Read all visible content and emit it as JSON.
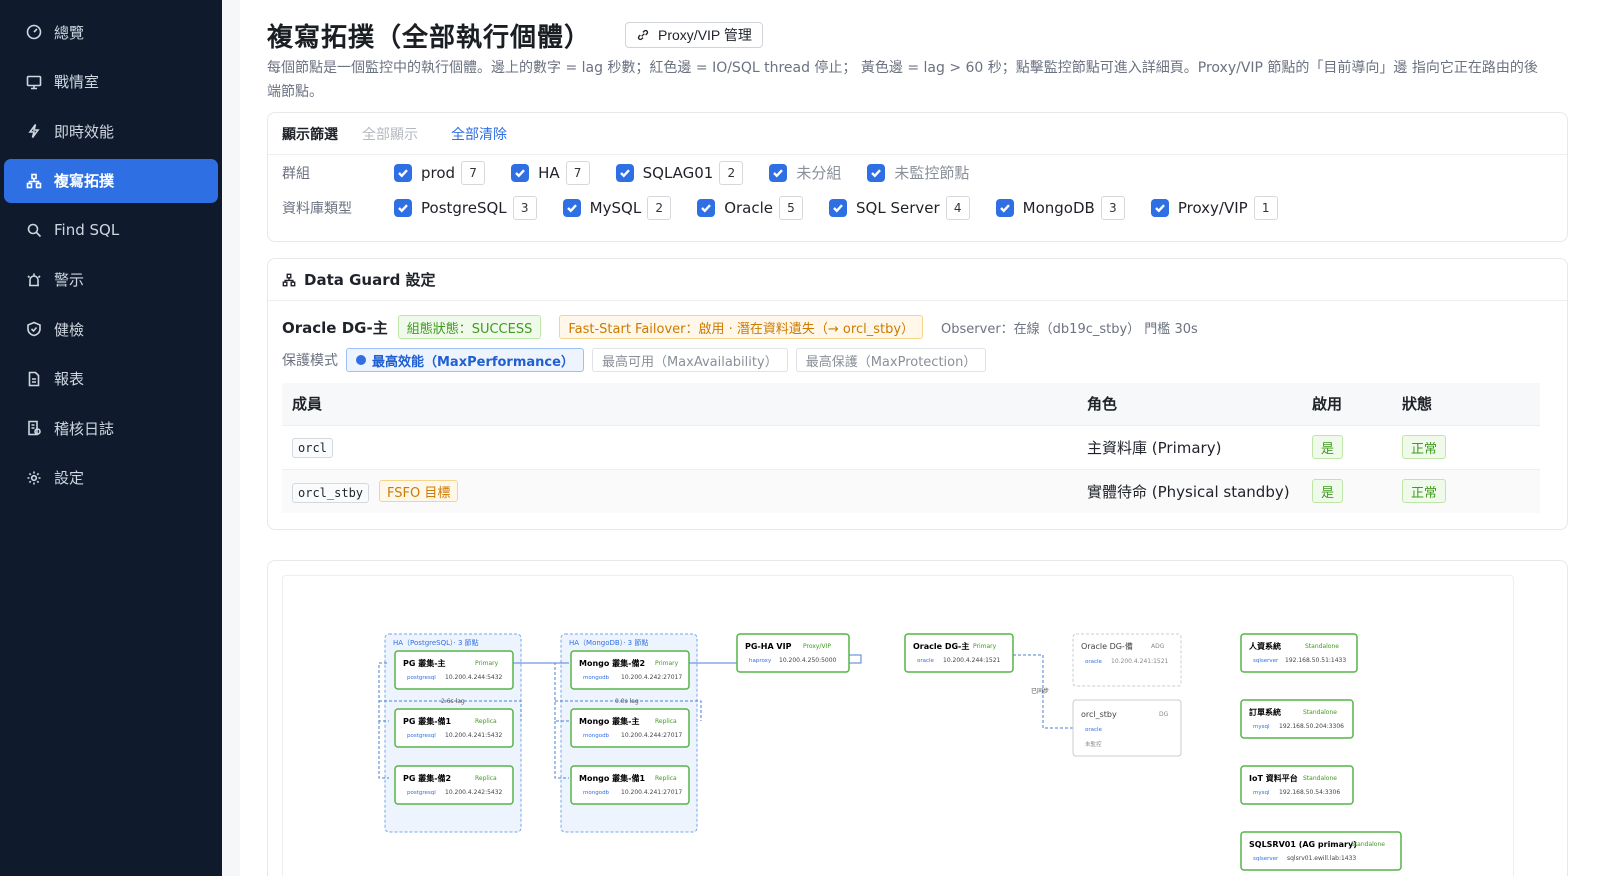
{
  "sidebar": {
    "items": [
      {
        "label": "總覽",
        "icon": "dashboard-icon"
      },
      {
        "label": "戰情室",
        "icon": "monitor-icon"
      },
      {
        "label": "即時效能",
        "icon": "bolt-icon"
      },
      {
        "label": "複寫拓撲",
        "icon": "topology-icon"
      },
      {
        "label": "Find SQL",
        "icon": "search-icon"
      },
      {
        "label": "警示",
        "icon": "alarm-icon"
      },
      {
        "label": "健檢",
        "icon": "shield-icon"
      },
      {
        "label": "報表",
        "icon": "report-icon"
      },
      {
        "label": "稽核日誌",
        "icon": "audit-log-icon"
      },
      {
        "label": "設定",
        "icon": "gear-icon"
      }
    ],
    "active": "複寫拓撲"
  },
  "page": {
    "title": "複寫拓撲（全部執行個體）",
    "proxy_button": "Proxy/VIP 管理",
    "description": "每個節點是一個監控中的執行個體。邊上的數字 = lag 秒數；紅色邊 = IO/SQL thread 停止； 黃色邊 = lag > 60 秒；點擊監控節點可進入詳細頁。Proxy/VIP 節點的「目前導向」邊 指向它正在路由的後端節點。"
  },
  "filters": {
    "title": "顯示篩選",
    "show_all": "全部顯示",
    "clear_all": "全部清除",
    "group_label": "群組",
    "groups": [
      {
        "label": "prod",
        "count": "7"
      },
      {
        "label": "HA",
        "count": "7"
      },
      {
        "label": "SQLAG01",
        "count": "2"
      },
      {
        "label": "未分組",
        "count": ""
      },
      {
        "label": "未監控節點",
        "count": ""
      }
    ],
    "db_type_label": "資料庫類型",
    "db_types": [
      {
        "label": "PostgreSQL",
        "count": "3"
      },
      {
        "label": "MySQL",
        "count": "2"
      },
      {
        "label": "Oracle",
        "count": "5"
      },
      {
        "label": "SQL Server",
        "count": "4"
      },
      {
        "label": "MongoDB",
        "count": "3"
      },
      {
        "label": "Proxy/VIP",
        "count": "1"
      }
    ]
  },
  "dataguard": {
    "title": "Data Guard 設定",
    "name": "Oracle DG-主",
    "status_tag": "組態狀態：SUCCESS",
    "fsfo_tag": "Fast-Start Failover：啟用 · 潛在資料遺失（→ orcl_stby）",
    "observer": "Observer：在線（db19c_stby） 門檻 30s",
    "mode_label": "保護模式",
    "modes": [
      "最高效能（MaxPerformance）",
      "最高可用（MaxAvailability）",
      "最高保護（MaxProtection）"
    ],
    "columns": [
      "成員",
      "角色",
      "啟用",
      "狀態"
    ],
    "members": [
      {
        "name": "orcl",
        "tag": "",
        "role": "主資料庫 (Primary)",
        "enabled": "是",
        "status": "正常"
      },
      {
        "name": "orcl_stby",
        "tag": "FSFO 目標",
        "role": "實體待命 (Physical standby)",
        "enabled": "是",
        "status": "正常"
      }
    ]
  },
  "topology": {
    "groups": [
      {
        "label": "HA（PostgreSQL）· 3 節點"
      },
      {
        "label": "HA（MongoDB）· 3 節點"
      }
    ],
    "nodes": [
      {
        "name": "PG 叢集-主",
        "role": "Primary",
        "type": "postgresql",
        "addr": "10.200.4.244:5432"
      },
      {
        "name": "PG 叢集-備1",
        "role": "Replica",
        "type": "postgresql",
        "addr": "10.200.4.241:5432"
      },
      {
        "name": "PG 叢集-備2",
        "role": "Replica",
        "type": "postgresql",
        "addr": "10.200.4.242:5432"
      },
      {
        "name": "Mongo 叢集-備2",
        "role": "Primary",
        "type": "mongodb",
        "addr": "10.200.4.242:27017"
      },
      {
        "name": "Mongo 叢集-主",
        "role": "Replica",
        "type": "mongodb",
        "addr": "10.200.4.244:27017"
      },
      {
        "name": "Mongo 叢集-備1",
        "role": "Replica",
        "type": "mongodb",
        "addr": "10.200.4.241:27017"
      },
      {
        "name": "PG-HA VIP",
        "role": "Proxy/VIP",
        "type": "haproxy",
        "addr": "10.200.4.250:5000"
      },
      {
        "name": "Oracle DG-主",
        "role": "Primary",
        "type": "oracle",
        "addr": "10.200.4.244:1521"
      },
      {
        "name": "Oracle DG-備",
        "role": "ADG",
        "type": "oracle",
        "addr": "10.200.4.241:1521"
      },
      {
        "name": "orcl_stby",
        "role": "DG",
        "type": "oracle",
        "addr": "未監控"
      },
      {
        "name": "人資系統",
        "role": "Standalone",
        "type": "sqlserver",
        "addr": "192.168.50.51:1433"
      },
      {
        "name": "訂單系統",
        "role": "Standalone",
        "type": "mysql",
        "addr": "192.168.50.204:3306"
      },
      {
        "name": "IoT 資料平台",
        "role": "Standalone",
        "type": "mysql",
        "addr": "192.168.50.54:3306"
      },
      {
        "name": "SQLSRV01 (AG primary)",
        "role": "Standalone",
        "type": "sqlserver",
        "addr": "sqlsrv01.ewill.lab:1433"
      }
    ],
    "lag_labels": [
      "2.6s lag",
      "0.0s lag"
    ],
    "sync_label": "已同步"
  },
  "colors": {
    "accent": "#2f6fe4",
    "sidebar_bg": "#0f1b2d",
    "success": "#3f9b1f",
    "warning": "#cc7a00"
  }
}
